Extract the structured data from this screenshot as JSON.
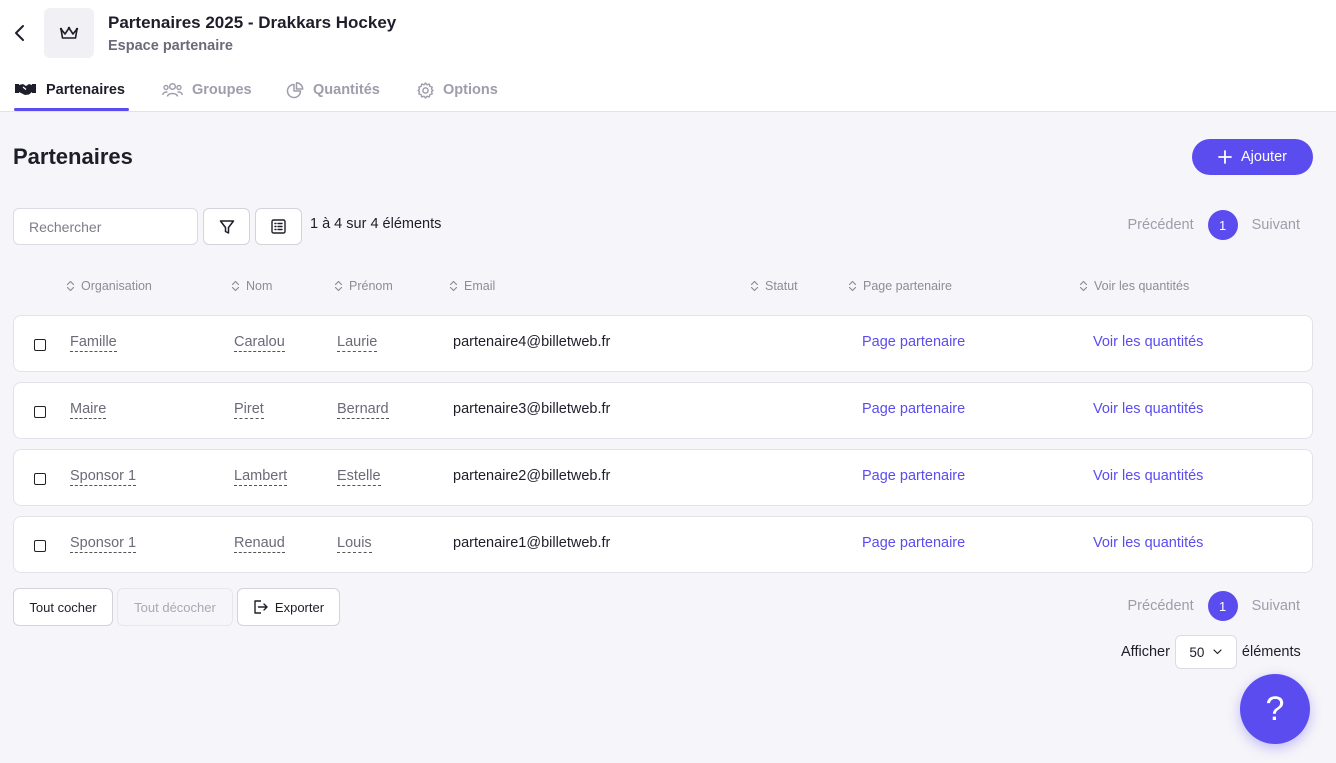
{
  "header": {
    "title": "Partenaires 2025 - Drakkars Hockey",
    "subtitle": "Espace partenaire",
    "back_icon": "chevron-left-icon",
    "app_icon": "crown-icon"
  },
  "tabs": [
    {
      "label": "Partenaires",
      "icon": "handshake-icon",
      "active": true
    },
    {
      "label": "Groupes",
      "icon": "users-icon",
      "active": false
    },
    {
      "label": "Quantités",
      "icon": "pie-chart-icon",
      "active": false
    },
    {
      "label": "Options",
      "icon": "gear-icon",
      "active": false
    }
  ],
  "main": {
    "title": "Partenaires",
    "add_label": "Ajouter",
    "search_placeholder": "Rechercher",
    "count_text": "1 à 4 sur 4 éléments"
  },
  "pagination": {
    "prev": "Précédent",
    "current": "1",
    "next": "Suivant"
  },
  "table": {
    "columns": [
      "Organisation",
      "Nom",
      "Prénom",
      "Email",
      "Statut",
      "Page partenaire",
      "Voir les quantités"
    ],
    "rows": [
      {
        "organisation": "Famille",
        "nom": "Caralou",
        "prenom": "Laurie",
        "email": "partenaire4@billetweb.fr",
        "page": "Page partenaire",
        "quantites": "Voir les quantités"
      },
      {
        "organisation": "Maire",
        "nom": "Piret",
        "prenom": "Bernard",
        "email": "partenaire3@billetweb.fr",
        "page": "Page partenaire",
        "quantites": "Voir les quantités"
      },
      {
        "organisation": "Sponsor 1",
        "nom": "Lambert",
        "prenom": "Estelle",
        "email": "partenaire2@billetweb.fr",
        "page": "Page partenaire",
        "quantites": "Voir les quantités"
      },
      {
        "organisation": "Sponsor 1",
        "nom": "Renaud",
        "prenom": "Louis",
        "email": "partenaire1@billetweb.fr",
        "page": "Page partenaire",
        "quantites": "Voir les quantités"
      }
    ]
  },
  "footer": {
    "check_all": "Tout cocher",
    "uncheck_all": "Tout décocher",
    "export": "Exporter",
    "show_label": "Afficher",
    "per_page": "50",
    "items_label": "éléments"
  },
  "help": {
    "label": "?"
  },
  "colors": {
    "accent": "#5b4cf0"
  }
}
